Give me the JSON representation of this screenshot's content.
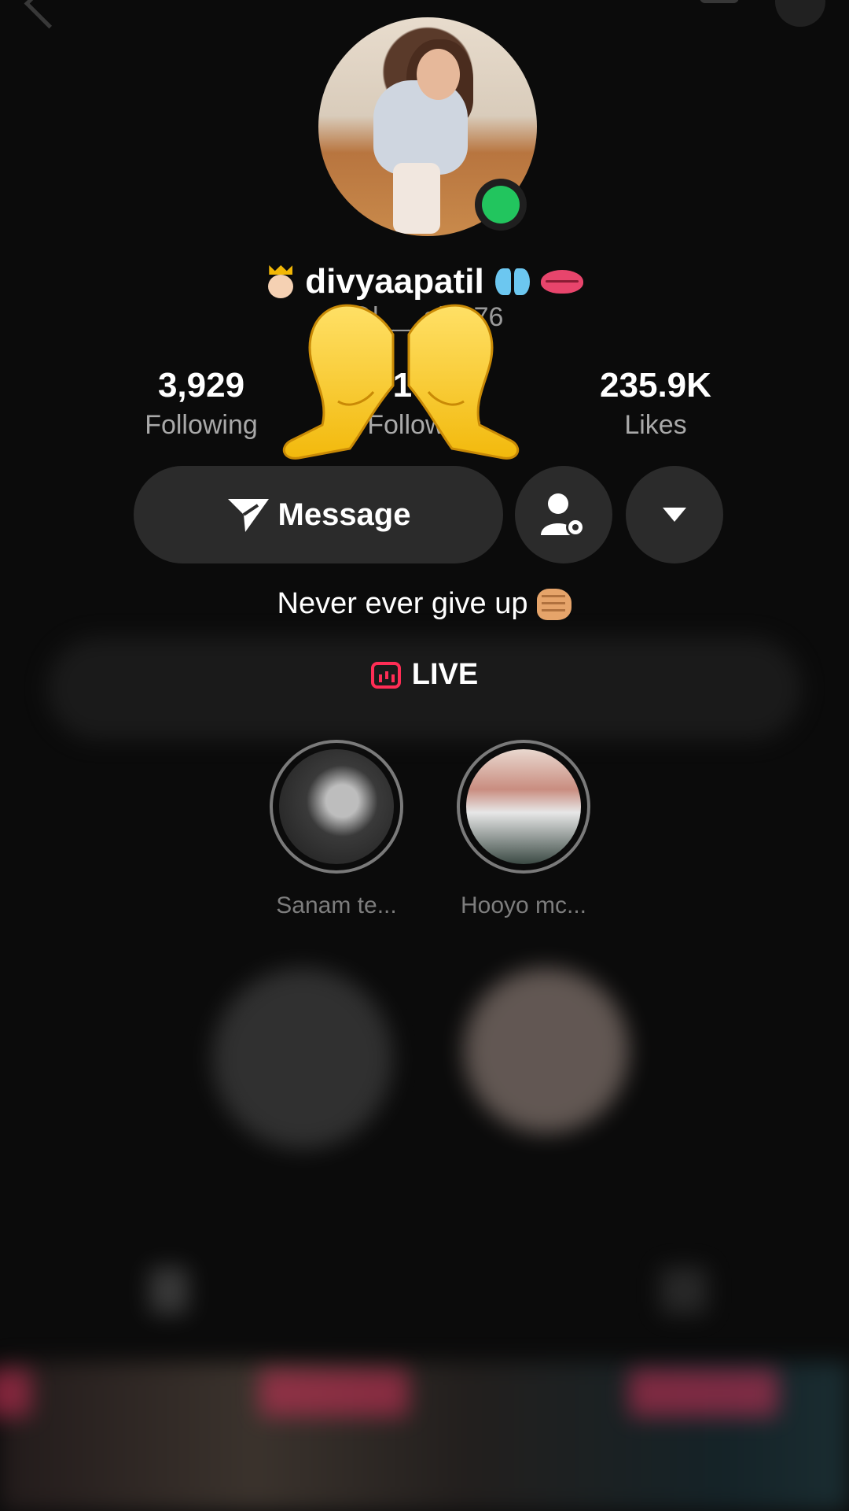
{
  "profile": {
    "display_name": "divyaapatil",
    "handle": "@l___ala076",
    "online": true,
    "bio": "Never ever give up"
  },
  "stats": {
    "following": {
      "value": "3,929",
      "label": "Following"
    },
    "followers": {
      "value": "15K",
      "label": "Followers"
    },
    "likes": {
      "value": "235.9K",
      "label": "Likes"
    }
  },
  "actions": {
    "message_label": "Message"
  },
  "live": {
    "label": "LIVE",
    "color": "#ff2d55"
  },
  "highlights": [
    {
      "label": "Sanam te..."
    },
    {
      "label": "Hooyo mc..."
    }
  ],
  "icons": [
    "crown-face-icon",
    "butterfly-icon",
    "lips-icon",
    "heart-hands-icon",
    "send-icon",
    "person-settings-icon",
    "dropdown-icon",
    "fist-icon",
    "live-icon"
  ],
  "colors": {
    "online": "#22c55e",
    "button_bg": "#2b2b2b",
    "background": "#0b0b0b"
  }
}
